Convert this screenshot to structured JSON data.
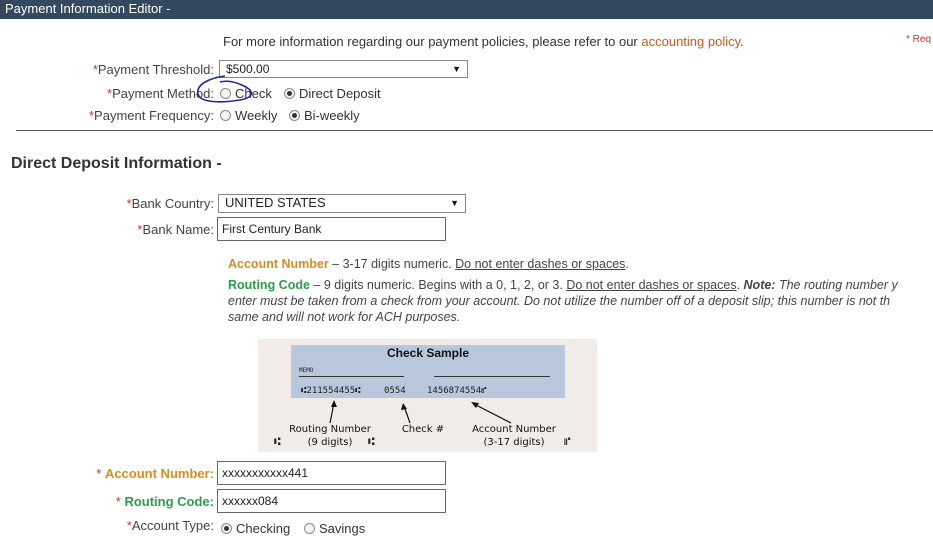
{
  "window": {
    "title": "Payment Information Editor -"
  },
  "intro": {
    "text": "For more information regarding our payment policies, please refer to our ",
    "link": "accounting policy",
    "suffix": "."
  },
  "required_note": "* Req",
  "payment": {
    "threshold_label": "Payment Threshold:",
    "threshold_value": "$500.00",
    "method_label": "Payment Method:",
    "method_options": [
      "Check",
      "Direct Deposit"
    ],
    "method_selected": "Direct Deposit",
    "frequency_label": "Payment Frequency:",
    "frequency_options": [
      "Weekly",
      "Bi-weekly"
    ],
    "frequency_selected": "Bi-weekly"
  },
  "direct_deposit": {
    "heading": "Direct Deposit Information -",
    "country_label": "Bank Country:",
    "country_value": "UNITED STATES",
    "bank_name_label": "Bank Name:",
    "bank_name_value": "First Century Bank",
    "acct_help_title": "Account Number",
    "acct_help_text": " – 3-17 digits numeric. ",
    "acct_help_warn": "Do not enter dashes or spaces",
    "routing_help_title": "Routing Code",
    "routing_help_text": " – 9 digits numeric. Begins with a 0, 1, 2, or 3. ",
    "routing_help_warn": "Do not enter dashes or spaces",
    "routing_note_label": "Note:",
    "routing_note_line1": " The routing number y",
    "routing_note_line2": "enter must be taken from a check from your account. Do not utilize the number off of a deposit slip; this number is not th",
    "routing_note_line3": "same and will not work for ACH purposes.",
    "check_sample": {
      "title": "Check Sample",
      "memo": "MEMO",
      "micr_routing": "⑆211554455⑆",
      "micr_check": "0554",
      "micr_account": "1456874554⑈",
      "routing_label": "Routing Number",
      "routing_digits": "(9 digits)",
      "check_label": "Check #",
      "account_label": "Account Number",
      "account_digits": "(3-17 digits)"
    },
    "account_number_label": "Account Number:",
    "account_number_value": "xxxxxxxxxxx441",
    "routing_code_label": "Routing Code:",
    "routing_code_value": "xxxxxx084",
    "account_type_label": "Account Type:",
    "account_type_options": [
      "Checking",
      "Savings"
    ],
    "account_type_selected": "Checking"
  },
  "colors": {
    "titlebar": "#34495e",
    "required": "#c0392b",
    "account_accent": "#d98b1e",
    "routing_accent": "#2e9c4a",
    "annotation": "#1a2a9a"
  }
}
